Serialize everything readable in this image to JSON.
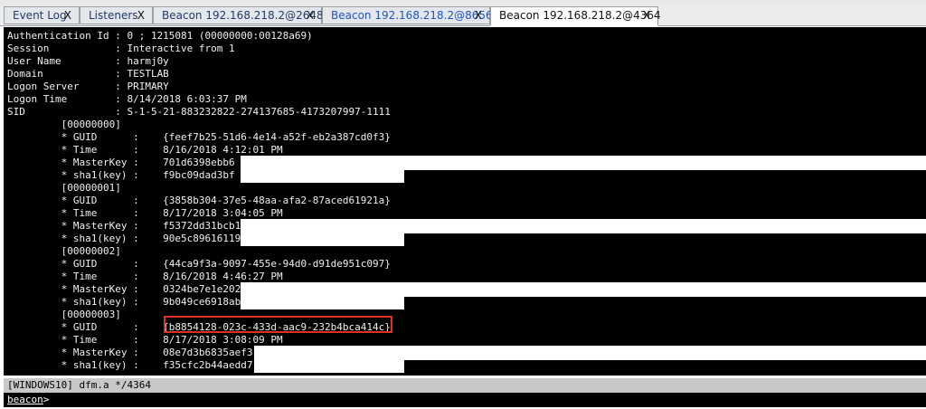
{
  "tabs": [
    {
      "label": "Event Log",
      "close": "X"
    },
    {
      "label": "Listeners",
      "close": "X"
    },
    {
      "label": "Beacon 192.168.218.2@2648",
      "close": "X"
    },
    {
      "label": "Beacon 192.168.218.2@8656",
      "close": "X"
    },
    {
      "label": "Beacon 192.168.218.2@4364",
      "close": "X"
    }
  ],
  "console": {
    "lines": [
      "Authentication Id : 0 ; 1215081 (00000000:00128a69)",
      "Session           : Interactive from 1",
      "User Name         : harmj0y",
      "Domain            : TESTLAB",
      "Logon Server      : PRIMARY",
      "Logon Time        : 8/14/2018 6:03:37 PM",
      "SID               : S-1-5-21-883232822-274137685-4173207997-1111",
      "         [00000000]",
      "         * GUID      :    {feef7b25-51d6-4e14-a52f-eb2a387cd0f3}",
      "         * Time      :    8/16/2018 4:12:01 PM",
      "         * MasterKey :    701d6398ebb6",
      "         * sha1(key) :    f9bc09dad3bf",
      "         [00000001]",
      "         * GUID      :    {3858b304-37e5-48aa-afa2-87aced61921a}",
      "         * Time      :    8/17/2018 3:04:05 PM",
      "         * MasterKey :    f5372dd31bcb1c",
      "         * sha1(key) :    90e5c89616119",
      "         [00000002]",
      "         * GUID      :    {44ca9f3a-9097-455e-94d0-d91de951c097}",
      "         * Time      :    8/16/2018 4:46:27 PM",
      "         * MasterKey :    0324be7e1e202",
      "         * sha1(key) :    9b049ce6918ab",
      "         [00000003]",
      "         * GUID      :    {b8854128-023c-433d-aac9-232b4bca414c}",
      "         * Time      :    8/17/2018 3:08:09 PM",
      "         * MasterKey :    08e7d3b6835aef3",
      "         * sha1(key) :    f35cfc2b44aedd7"
    ]
  },
  "status": {
    "text": "[WINDOWS10] dfm.a */4364"
  },
  "prompt": {
    "label": "beacon",
    "suffix": ">"
  }
}
